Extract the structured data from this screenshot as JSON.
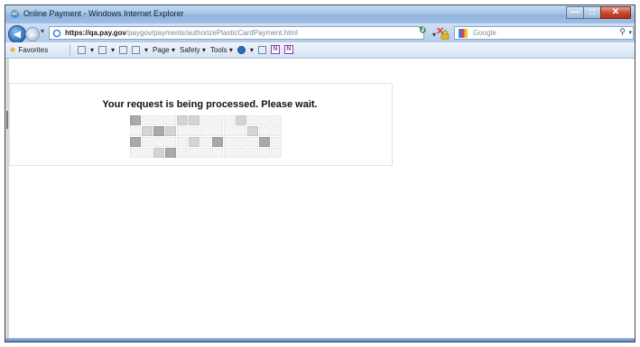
{
  "window": {
    "title": "Online Payment - Windows Internet Explorer",
    "icon": "ie-icon",
    "controls": [
      "minimize-icon",
      "maximize-icon",
      "close-icon"
    ]
  },
  "address_bar": {
    "url_scheme": "https://",
    "url_host": "qa.pay.gov",
    "url_path": "/paygov/payments/authorizePlasticCardPayment.html",
    "search_placeholder": "Google"
  },
  "command_bar": {
    "favorites_label": "Favorites",
    "page_label": "Page",
    "safety_label": "Safety",
    "tools_label": "Tools"
  },
  "content": {
    "message": "Your request is being processed. Please wait.",
    "loading_grid": {
      "columns": 13,
      "rows": [
        [
          "d",
          "l",
          "l",
          "l",
          "m",
          "m",
          "l",
          "l",
          "l",
          "m",
          "l",
          "l",
          "l"
        ],
        [
          "l",
          "m",
          "d",
          "m",
          "l",
          "l",
          "l",
          "l",
          "l",
          "l",
          "m",
          "l",
          "l"
        ],
        [
          "d",
          "l",
          "l",
          "l",
          "l",
          "m",
          "l",
          "d",
          "l",
          "l",
          "l",
          "d",
          "l"
        ],
        [
          "l",
          "l",
          "m",
          "d",
          "l",
          "l",
          "l",
          "l",
          "l",
          "l",
          "l",
          "l",
          "l"
        ]
      ]
    }
  },
  "colors": {
    "titlebar": "#a7c4e6",
    "close_button": "#c7452a",
    "loading_dark": "#a9a9a9",
    "loading_mid": "#d4d4d4",
    "loading_light": "#f4f4f4"
  }
}
